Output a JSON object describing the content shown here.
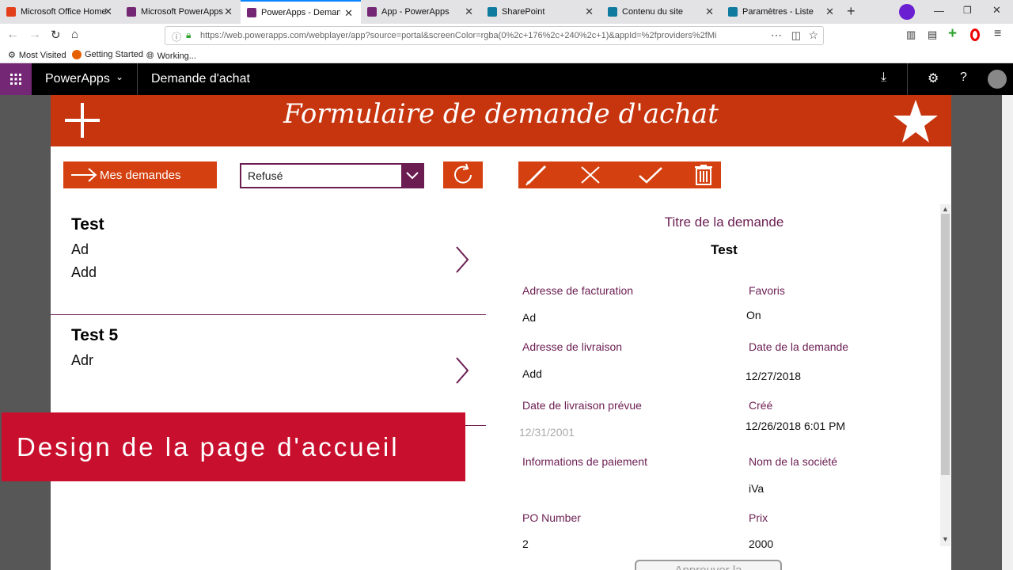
{
  "browser": {
    "tabs": [
      {
        "label": "Microsoft Office Home",
        "color": "#e43f1b"
      },
      {
        "label": "Microsoft PowerApps",
        "color": "#742774"
      },
      {
        "label": "PowerApps - Demande",
        "color": "#742774"
      },
      {
        "label": "App - PowerApps",
        "color": "#742774"
      },
      {
        "label": "SharePoint",
        "color": "#0f7b9f"
      },
      {
        "label": "Contenu du site",
        "color": "#0f7b9f"
      },
      {
        "label": "Paramètres - Liste",
        "color": "#0f7b9f"
      }
    ],
    "url": "https://web.powerapps.com/webplayer/app?source=portal&screenColor=rgba(0%2c+176%2c+240%2c+1)&appId=%2fproviders%2fMi",
    "bookmarks": [
      "Most Visited",
      "Getting Started",
      "Working..."
    ]
  },
  "powerapps_bar": {
    "product": "PowerApps",
    "app_name": "Demande d'achat"
  },
  "app": {
    "title": "Formulaire de demande d'achat",
    "my_requests_label": "Mes demandes",
    "status_filter_value": "Refusé",
    "list": [
      {
        "title": "Test",
        "lines": [
          "Ad",
          "Add"
        ]
      },
      {
        "title": "Test 5",
        "lines": [
          "Adr"
        ]
      }
    ],
    "detail": {
      "title_label": "Titre de la demande",
      "title_value": "Test",
      "fields": {
        "billing_label": "Adresse de facturation",
        "billing_value": "Ad",
        "favorites_label": "Favoris",
        "favorites_value": "On",
        "shipping_label": "Adresse de livraison",
        "shipping_value": "Add",
        "request_date_label": "Date de la demande",
        "request_date_value": "12/27/2018",
        "expected_label": "Date de livraison prévue",
        "expected_value": "12/31/2001",
        "created_label": "Créé",
        "created_value": "12/26/2018 6:01 PM",
        "payment_label": "Informations de paiement",
        "payment_value": "",
        "company_label": "Nom de la société",
        "company_value": "iVa",
        "po_label": "PO Number",
        "po_value": "2",
        "price_label": "Prix",
        "price_value": "2000"
      },
      "approve_label": "Approuver la"
    }
  },
  "overlay": {
    "caption": "Design de la page d'accueil"
  },
  "colors": {
    "brand": "#c7350f",
    "accent": "#6b1d52",
    "overlay": "#c8102e"
  }
}
